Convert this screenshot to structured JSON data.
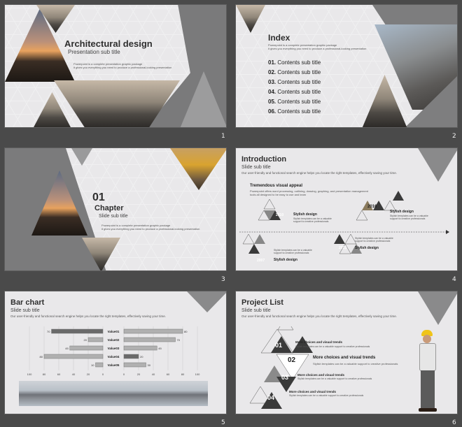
{
  "slides": [
    {
      "num": "1",
      "title": "Architectural design",
      "subtitle": "Presentation sub title",
      "body_lines": [
        "Powerpoint  is  a  complete  presentation  graphic  package",
        "it  gives  you  everything  you  need  to  produce  a  professional-looking  presentation"
      ]
    },
    {
      "num": "2",
      "title": "Index",
      "body_lines": [
        "Powerpoint  is  a  complete  presentation  graphic  package",
        "it  gives  you  everything  you  need  to  produce  a  professional-looking  presentation"
      ],
      "items": [
        {
          "n": "01.",
          "t": "Contents sub title"
        },
        {
          "n": "02.",
          "t": "Contents sub title"
        },
        {
          "n": "03.",
          "t": "Contents sub title"
        },
        {
          "n": "04.",
          "t": "Contents sub title"
        },
        {
          "n": "05.",
          "t": "Contents sub title"
        },
        {
          "n": "06.",
          "t": "Contents sub title"
        }
      ]
    },
    {
      "num": "3",
      "big_num": "01",
      "title": "Chapter",
      "subtitle": "Slide sub title",
      "body_lines": [
        "Powerpoint  is  a  complete  presentation  graphic  package",
        "it  gives  you  everything  you  need  to  produce  a  professional-looking  presentation"
      ]
    },
    {
      "num": "4",
      "title": "Introduction",
      "subtitle": "Slide sub title",
      "desc": "Our user-friendly and functional search engine helps you locate the right templates, effectively saving your time.",
      "heading": "Tremendous visual appeal",
      "heading_body": [
        "Powerpoint  offers  word  processing,  outlining,  drawing,  graphing,  and  presentation  management",
        "tools  all designed  to  be  easy  to  use  and  learn"
      ],
      "years": [
        "2010",
        "2016",
        "2013",
        "2007"
      ],
      "style_label": "Stylish  design",
      "style_body": [
        "Stylish  templates  can  be  a  valuable",
        "support  to  creative  professionals"
      ]
    },
    {
      "num": "5",
      "title": "Bar chart",
      "subtitle": "Slide sub title",
      "desc": "Our user-friendly and functional search engine helps you locate the right templates, effectively saving your time.",
      "chart_data": {
        "type": "bar",
        "categories": [
          "Value01",
          "Value02",
          "Value03",
          "Value04",
          "Value05"
        ],
        "series": [
          {
            "values": [
              70,
              20,
              45,
              80,
              10
            ]
          },
          {
            "values": [
              80,
              70,
              45,
              20,
              30
            ]
          }
        ],
        "xticks_left": [
          "100",
          "80",
          "60",
          "40",
          "20",
          "0"
        ],
        "xticks_right": [
          "0",
          "20",
          "40",
          "60",
          "80",
          "100"
        ],
        "ylim": [
          0,
          100
        ]
      }
    },
    {
      "num": "6",
      "title": "Project List",
      "subtitle": "Slide sub title",
      "desc": "Our user-friendly and functional search engine helps you locate the right templates, effectively saving your time.",
      "items": [
        {
          "n": "01",
          "t": "More  choices  and  visual  trends",
          "b": "Stylish  templates  can  be  a  valuable  support  to  creative  professionals"
        },
        {
          "n": "02",
          "t": "More choices and visual trends",
          "b": "Stylish templates can be a valuable support to creative professionals"
        },
        {
          "n": "03",
          "t": "More  choices  and  visual  trends",
          "b": "Stylish  templates  can  be  a  valuable  support  to  creative  professionals"
        },
        {
          "n": "04",
          "t": "More  choices  and  visual  trends",
          "b": "Stylish  templates  can  be  a  valuable  support  to  creative  professionals"
        }
      ]
    }
  ],
  "colors": {
    "bg": "#4a4a4a",
    "slide": "#e9e8ea",
    "gray": "#6f6f6f",
    "dark": "#2f2f2f"
  }
}
